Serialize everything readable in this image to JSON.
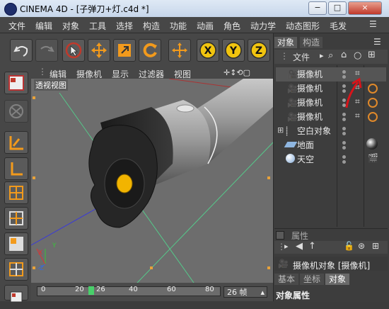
{
  "window": {
    "app_name": "CINEMA 4D",
    "document": "[子弹刀+灯.c4d *]",
    "minimize": "−",
    "maximize": "□",
    "close": "×"
  },
  "menu": [
    "文件",
    "编辑",
    "对象",
    "工具",
    "选择",
    "构造",
    "功能",
    "动画",
    "角色",
    "动力学",
    "动态图形",
    "毛发"
  ],
  "toolbar": {
    "icons": [
      "undo-icon",
      "redo-icon",
      "select-cursor-icon",
      "move-icon",
      "scale-icon",
      "rotate-icon",
      "add-icon",
      "x-axis-icon",
      "y-axis-icon",
      "z-axis-icon"
    ],
    "axis_x": "X",
    "axis_y": "Y",
    "axis_z": "Z"
  },
  "viewport": {
    "menu": [
      "编辑",
      "摄像机",
      "显示",
      "过滤器",
      "视图"
    ],
    "label": "透视视图",
    "axis_labels": {
      "x": "X",
      "y": "Y",
      "z": "Z"
    }
  },
  "timeline": {
    "ticks": [
      "0",
      "20",
      "26",
      "40",
      "60",
      "80"
    ],
    "current_frame": "26",
    "fps": "26 帧"
  },
  "object_manager": {
    "tabs": [
      "对象",
      "构造"
    ],
    "menu": [
      "文件"
    ],
    "objects": [
      {
        "name": "摄像机",
        "selected": true
      },
      {
        "name": "摄像机"
      },
      {
        "name": "摄像机"
      },
      {
        "name": "摄像机"
      },
      {
        "name": "空白对象"
      },
      {
        "name": "地面"
      },
      {
        "name": "天空"
      }
    ]
  },
  "attributes": {
    "title": "属性",
    "object_line": "摄像机对象 [摄像机]",
    "tabs": [
      "基本",
      "坐标",
      "对象"
    ],
    "section": "对象属性"
  },
  "annotation_color": "#d8141a"
}
